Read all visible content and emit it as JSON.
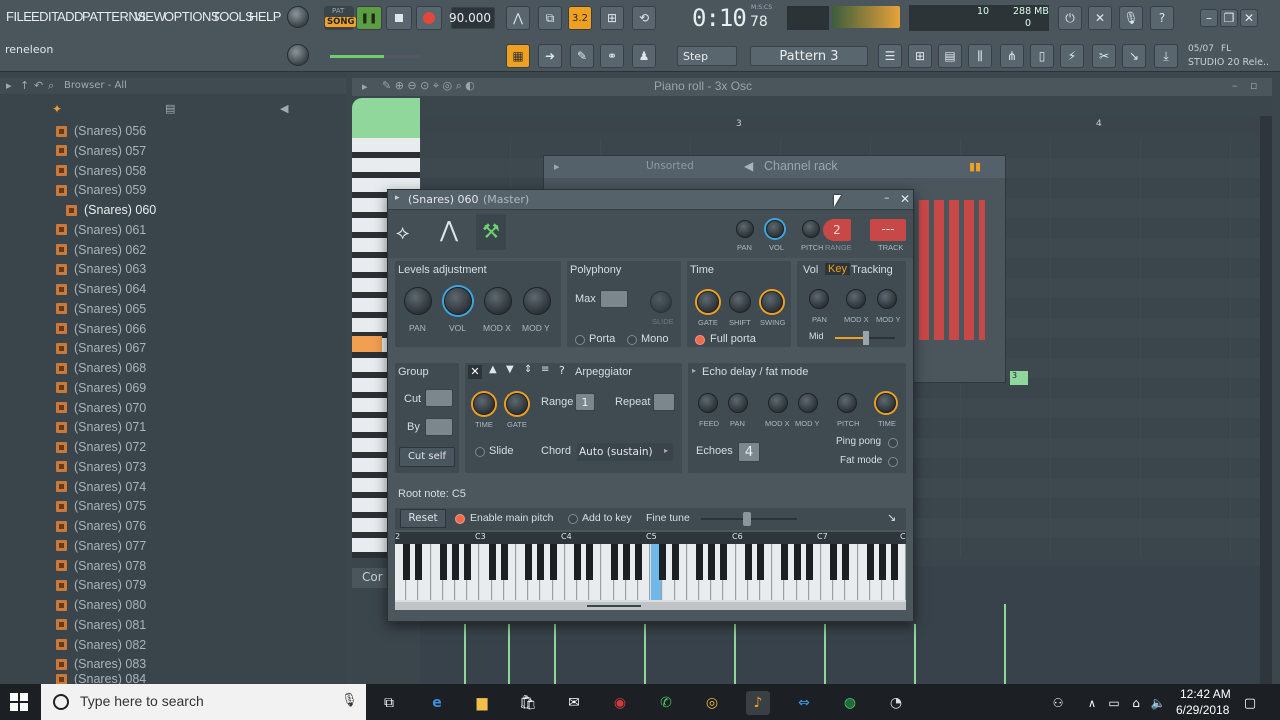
{
  "menu": {
    "file": "FILE",
    "edit": "EDIT",
    "add": "ADD",
    "patterns": "PATTERNS",
    "view": "VIEW",
    "options": "OPTIONS",
    "tools": "TOOLS",
    "help": "HELP"
  },
  "transport": {
    "song_label": "SONG",
    "pat_label": "PAT",
    "tempo": "90.000",
    "time": "0:10",
    "time_sub": "78",
    "time_unit": "M:S:CS",
    "cpu_value": "10",
    "mem_value": "288 MB",
    "poly_value": "0",
    "snap": "Step",
    "pattern": "Pattern 3",
    "user": "reneleon",
    "fl_date": "05/07",
    "fl_version": "FL",
    "fl_label": "STUDIO 20 Rele..",
    "rec_count": "3.2"
  },
  "browser": {
    "title": "Browser - All",
    "items": [
      "(Snares) 056",
      "(Snares) 057",
      "(Snares) 058",
      "(Snares) 059",
      "(Snares) 060",
      "(Snares) 061",
      "(Snares) 062",
      "(Snares) 063",
      "(Snares) 064",
      "(Snares) 065",
      "(Snares) 066",
      "(Snares) 067",
      "(Snares) 068",
      "(Snares) 069",
      "(Snares) 070",
      "(Snares) 071",
      "(Snares) 072",
      "(Snares) 073",
      "(Snares) 074",
      "(Snares) 075",
      "(Snares) 076",
      "(Snares) 077",
      "(Snares) 078",
      "(Snares) 079",
      "(Snares) 080",
      "(Snares) 081",
      "(Snares) 082",
      "(Snares) 083",
      "(Snares) 084"
    ],
    "selected": "(Snares) 060"
  },
  "piano_roll": {
    "title": "Piano roll - 3x Osc",
    "bar3": "3",
    "bar4": "4",
    "cor_label": "Cor"
  },
  "channel_rack": {
    "title": "Channel rack",
    "filter": "Unsorted",
    "pattern_marker": "3"
  },
  "plugin": {
    "title": "(Snares) 060",
    "title_suffix": "(Master)",
    "pan_label": "PAN",
    "vol_label": "VOL",
    "pitch_label": "PITCH",
    "range_label": "RANGE",
    "track_label": "TRACK",
    "range_value": "2",
    "track_value": "---",
    "levels": {
      "title": "Levels adjustment",
      "pan": "PAN",
      "vol": "VOL",
      "modx": "MOD X",
      "mody": "MOD Y"
    },
    "polyphony": {
      "title": "Polyphony",
      "max": "Max",
      "slide": "SLIDE",
      "porta": "Porta",
      "mono": "Mono"
    },
    "time": {
      "title": "Time",
      "gate": "GATE",
      "shift": "SHIFT",
      "swing": "SWING",
      "full_porta": "Full porta"
    },
    "tracking": {
      "vol": "Vol",
      "key": "Key",
      "title": "Tracking",
      "pan": "PAN",
      "modx": "MOD X",
      "mody": "MOD Y",
      "mid": "Mid"
    },
    "group": {
      "title": "Group",
      "cut": "Cut",
      "by": "By",
      "cut_self": "Cut self"
    },
    "arp": {
      "title": "Arpeggiator",
      "time": "TIME",
      "gate": "GATE",
      "range": "Range",
      "range_value": "1",
      "repeat": "Repeat",
      "slide": "Slide",
      "chord": "Chord",
      "chord_value": "Auto (sustain)"
    },
    "echo": {
      "title": "Echo delay / fat mode",
      "feed": "FEED",
      "pan": "PAN",
      "modx": "MOD X",
      "mody": "MOD Y",
      "pitch": "PITCH",
      "time": "TIME",
      "echoes": "Echoes",
      "echoes_value": "4",
      "ping_pong": "Ping pong",
      "fat_mode": "Fat mode"
    },
    "root": {
      "title": "Root note: C5",
      "reset": "Reset",
      "enable_main_pitch": "Enable main pitch",
      "add_to_key": "Add to key",
      "fine_tune": "Fine tune"
    },
    "keyboard": {
      "c2": "2",
      "c3": "C3",
      "c4": "C4",
      "c5": "C5",
      "c6": "C6",
      "c7": "C7",
      "c8": "C"
    }
  },
  "taskbar": {
    "search_placeholder": "Type here to search",
    "time": "12:42 AM",
    "date": "6/29/2018"
  },
  "colors": {
    "accent": "#f0a020",
    "knob_blue": "#3da6e0",
    "green": "#5fcf7a",
    "title_red": "#c84848"
  }
}
